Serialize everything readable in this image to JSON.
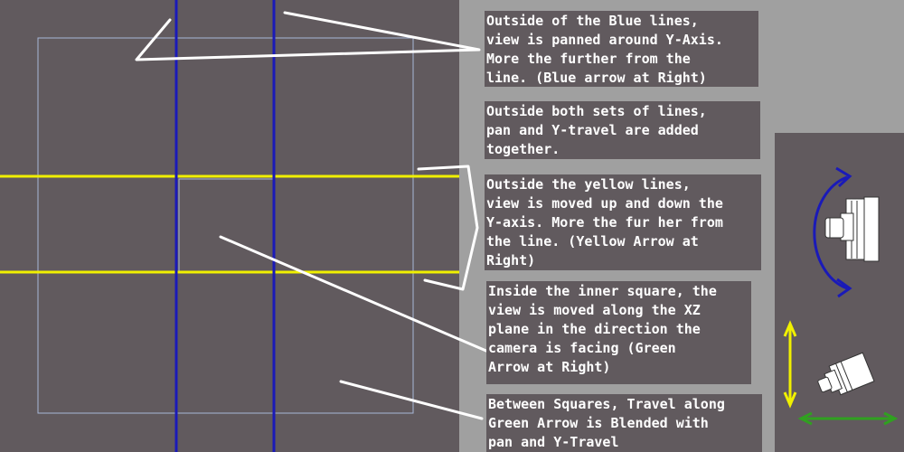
{
  "notes": [
    {
      "id": "blue",
      "text": "Outside of the Blue lines,\nview is panned around Y-Axis.\nMore the further from the\nline. (Blue arrow at Right)"
    },
    {
      "id": "both",
      "text": "Outside both sets of lines,\npan and Y-travel are added\ntogether."
    },
    {
      "id": "yellow",
      "text": "Outside the yellow lines,\nview is moved up and down the\nY-axis. More the fur her from\nthe line. (Yellow Arrow at\nRight)"
    },
    {
      "id": "inner",
      "text": "Inside the inner square, the\nview is moved along the XZ\nplane in the direction the\ncamera is facing (Green\nArrow at Right)"
    },
    {
      "id": "between",
      "text": "Between Squares, Travel along\nGreen Arrow is Blended with\npan and Y-Travel"
    }
  ],
  "colors": {
    "background": "#615a5e",
    "side_panel": "#a0a0a0",
    "blue_lines": "#1a1ab8",
    "yellow_lines": "#f0f000",
    "green_arrow": "#30a020",
    "square_outline": "#a8b8d8",
    "pointer_lines": "#ffffff"
  },
  "icons": [
    "camera-pan-icon",
    "camera-icon",
    "blue-curved-arrow-icon",
    "yellow-vertical-arrow-icon",
    "green-horizontal-arrow-icon"
  ]
}
